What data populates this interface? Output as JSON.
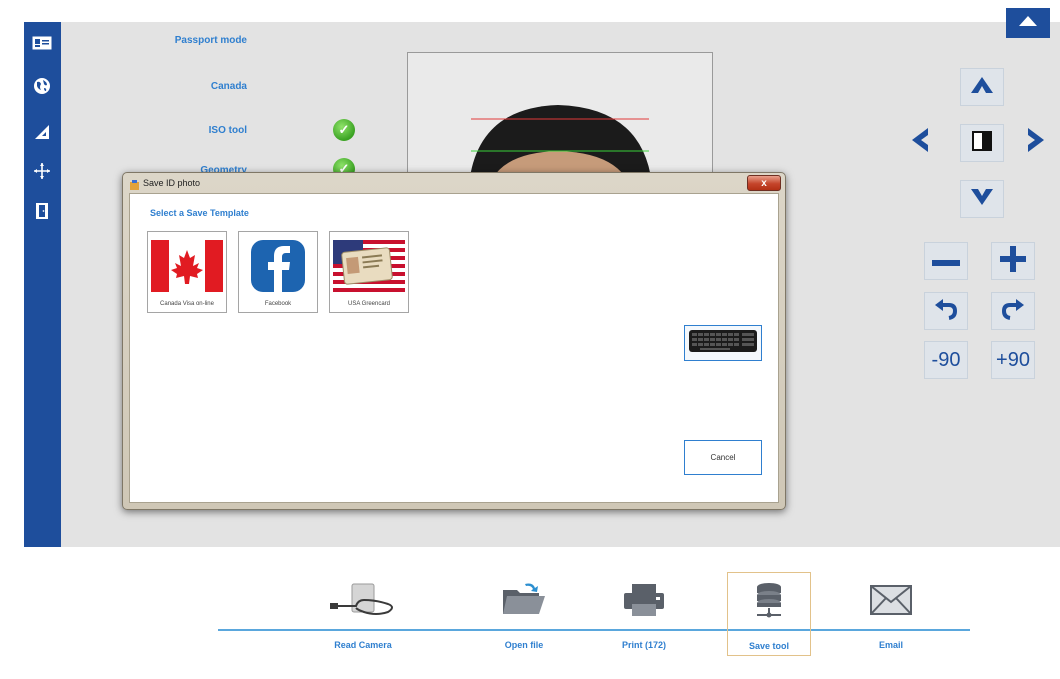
{
  "modes": {
    "passport_mode": "Passport mode",
    "country": "Canada",
    "iso_tool": "ISO tool",
    "geometry": "Geometry"
  },
  "controls": {
    "minus_90": "-90",
    "plus_90": "+90"
  },
  "dialog": {
    "title": "Save ID photo",
    "close_label": "x",
    "select_label": "Select a Save Template",
    "templates": [
      {
        "label": "Canada Visa on-line",
        "icon": "canada-flag-icon"
      },
      {
        "label": "Facebook",
        "icon": "facebook-icon"
      },
      {
        "label": "USA Greencard",
        "icon": "usa-greencard-icon"
      }
    ],
    "cancel_label": "Cancel"
  },
  "bottom_toolbar": {
    "items": [
      {
        "label": "Read Camera",
        "icon": "camera-cable-icon"
      },
      {
        "label": "Open file",
        "icon": "open-folder-icon"
      },
      {
        "label": "Print  (172)",
        "icon": "printer-icon"
      },
      {
        "label": "Save tool",
        "icon": "database-icon",
        "selected": true
      },
      {
        "label": "Email",
        "icon": "envelope-icon"
      }
    ]
  },
  "colors": {
    "accent_blue": "#1e4e9c",
    "label_blue": "#2f7fcf",
    "check_green": "#3aa222"
  }
}
